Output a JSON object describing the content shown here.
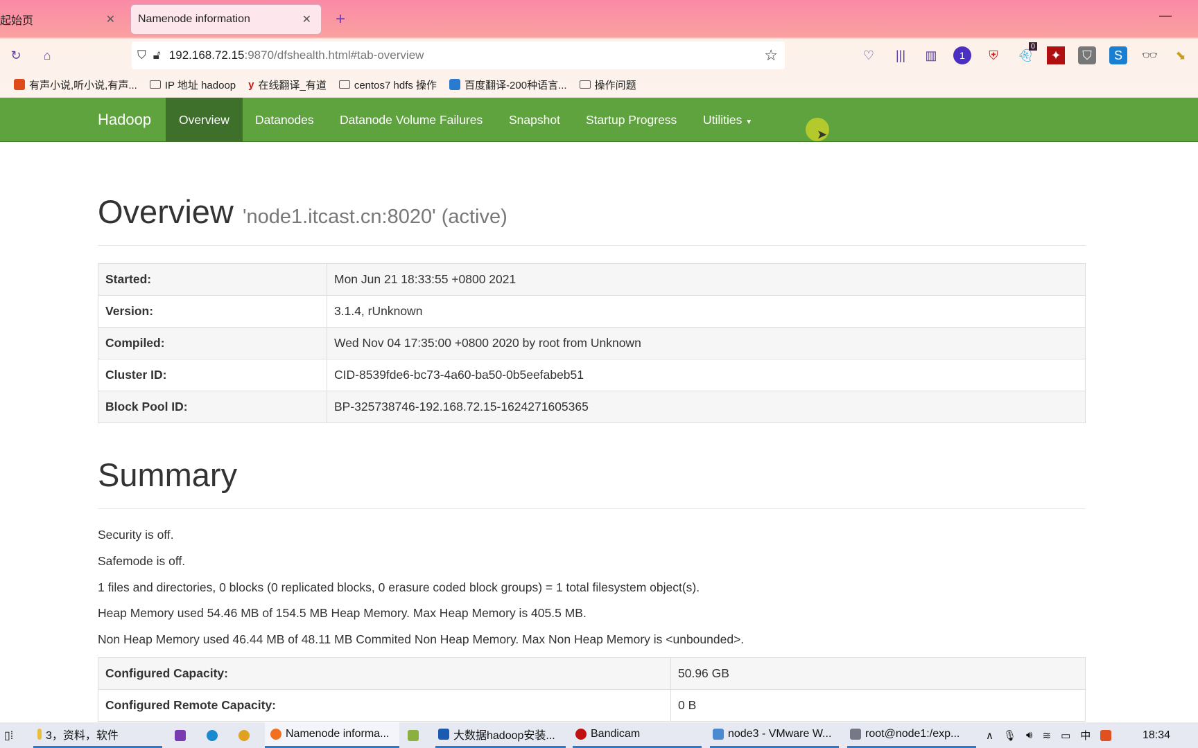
{
  "browser": {
    "tabs": [
      {
        "label": "起始页"
      },
      {
        "label": "Namenode information"
      }
    ],
    "url_host": "192.168.72.15",
    "url_rest": ":9870/dfshealth.html#tab-overview",
    "extension_badge": "0",
    "extension_count": "1",
    "bookmarks": [
      {
        "label": "有声小说,听小说,有声...",
        "icon": "radio-icon"
      },
      {
        "label": "IP 地址  hadoop",
        "icon": "folder-icon"
      },
      {
        "label": "在线翻译_有道",
        "icon": "youdao-icon"
      },
      {
        "label": "centos7  hdfs  操作",
        "icon": "folder-icon"
      },
      {
        "label": "百度翻译-200种语言...",
        "icon": "baidu-translate-icon"
      },
      {
        "label": "操作问题",
        "icon": "folder-icon"
      }
    ]
  },
  "navbar": {
    "brand": "Hadoop",
    "items": [
      "Overview",
      "Datanodes",
      "Datanode Volume Failures",
      "Snapshot",
      "Startup Progress",
      "Utilities"
    ],
    "active": "Overview",
    "color": "#5fa33e"
  },
  "overview": {
    "title": "Overview",
    "subtitle": "'node1.itcast.cn:8020' (active)",
    "rows": [
      {
        "k": "Started:",
        "v": "Mon Jun 21 18:33:55 +0800 2021"
      },
      {
        "k": "Version:",
        "v": "3.1.4, rUnknown"
      },
      {
        "k": "Compiled:",
        "v": "Wed Nov 04 17:35:00 +0800 2020 by root from Unknown"
      },
      {
        "k": "Cluster ID:",
        "v": "CID-8539fde6-bc73-4a60-ba50-0b5eefabeb51"
      },
      {
        "k": "Block Pool ID:",
        "v": "BP-325738746-192.168.72.15-1624271605365"
      }
    ]
  },
  "summary": {
    "title": "Summary",
    "lines": [
      "Security is off.",
      "Safemode is off.",
      "1 files and directories, 0 blocks (0 replicated blocks, 0 erasure coded block groups) = 1 total filesystem object(s).",
      "Heap Memory used 54.46 MB of 154.5 MB Heap Memory. Max Heap Memory is 405.5 MB.",
      "Non Heap Memory used 46.44 MB of 48.11 MB Commited Non Heap Memory. Max Non Heap Memory is <unbounded>."
    ],
    "rows": [
      {
        "k": "Configured Capacity:",
        "v": "50.96 GB"
      },
      {
        "k": "Configured Remote Capacity:",
        "v": "0 B"
      }
    ]
  },
  "taskbar": {
    "items": [
      "3，资料，软件",
      "Namenode informa...",
      "大数据hadoop安装...",
      "Bandicam",
      "node3 - VMware W...",
      "root@node1:/exp..."
    ],
    "clock": "18:34"
  }
}
